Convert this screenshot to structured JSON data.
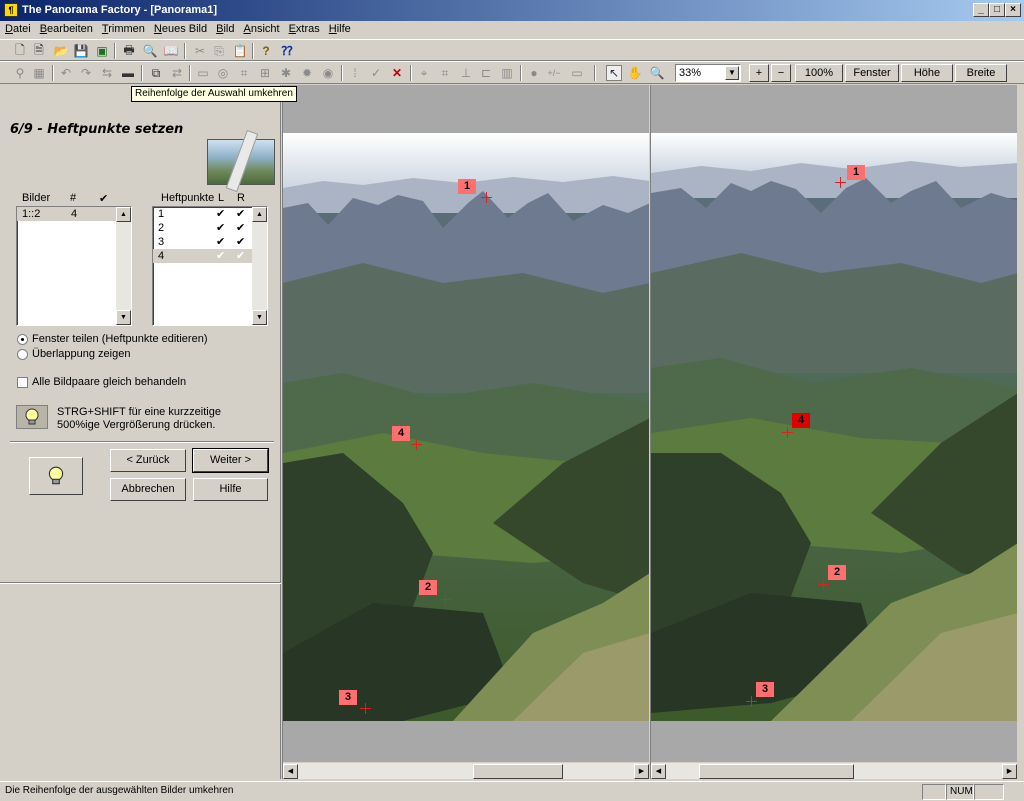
{
  "window": {
    "title": "The Panorama Factory - [Panorama1]",
    "controls": [
      "_",
      "□",
      "×"
    ]
  },
  "menu": [
    "Datei",
    "Bearbeiten",
    "Trimmen",
    "Neues Bild",
    "Bild",
    "Ansicht",
    "Extras",
    "Hilfe"
  ],
  "toolbar": {
    "zoom_value": "33%",
    "plus": "+",
    "minus": "−",
    "zoom100": "100%",
    "fit_window": "Fenster",
    "fit_height": "Höhe",
    "fit_width": "Breite"
  },
  "tooltip": "Reihenfolge der Auswahl umkehren",
  "wizard": {
    "step": "6/9 - Heftpunkte setzen",
    "images_header": {
      "bilder": "Bilder",
      "count": "#",
      "check": "✔"
    },
    "image_pairs": [
      {
        "pair": "1::2",
        "count": "4"
      }
    ],
    "points_header": {
      "label": "Heftpunkte",
      "l": "L",
      "r": "R"
    },
    "points": [
      {
        "id": "1",
        "l": "✔",
        "r": "✔"
      },
      {
        "id": "2",
        "l": "✔",
        "r": "✔"
      },
      {
        "id": "3",
        "l": "✔",
        "r": "✔"
      },
      {
        "id": "4",
        "l": "✔",
        "r": "✔"
      }
    ],
    "option_split": "Fenster teilen (Heftpunkte editieren)",
    "option_overlap": "Überlappung zeigen",
    "option_all_pairs": "Alle Bildpaare gleich behandeln",
    "hint": "STRG+SHIFT für eine kurzzeitige 500%ige Vergrößerung drücken.",
    "back": "< Zurück",
    "next": "Weiter >",
    "cancel": "Abbrechen",
    "help": "Hilfe"
  },
  "left_markers": [
    {
      "label": "1"
    },
    {
      "label": "4"
    },
    {
      "label": "2"
    },
    {
      "label": "3"
    }
  ],
  "right_markers": [
    {
      "label": "1"
    },
    {
      "label": "4"
    },
    {
      "label": "2"
    },
    {
      "label": "3"
    }
  ],
  "status": {
    "text": "Die Reihenfolge der ausgewählten Bilder umkehren",
    "num": "NUM"
  },
  "colors": {
    "marker": "#ff6f6f",
    "marker_active": "#e00000",
    "title_start": "#0a246a",
    "title_end": "#a6caf0"
  }
}
